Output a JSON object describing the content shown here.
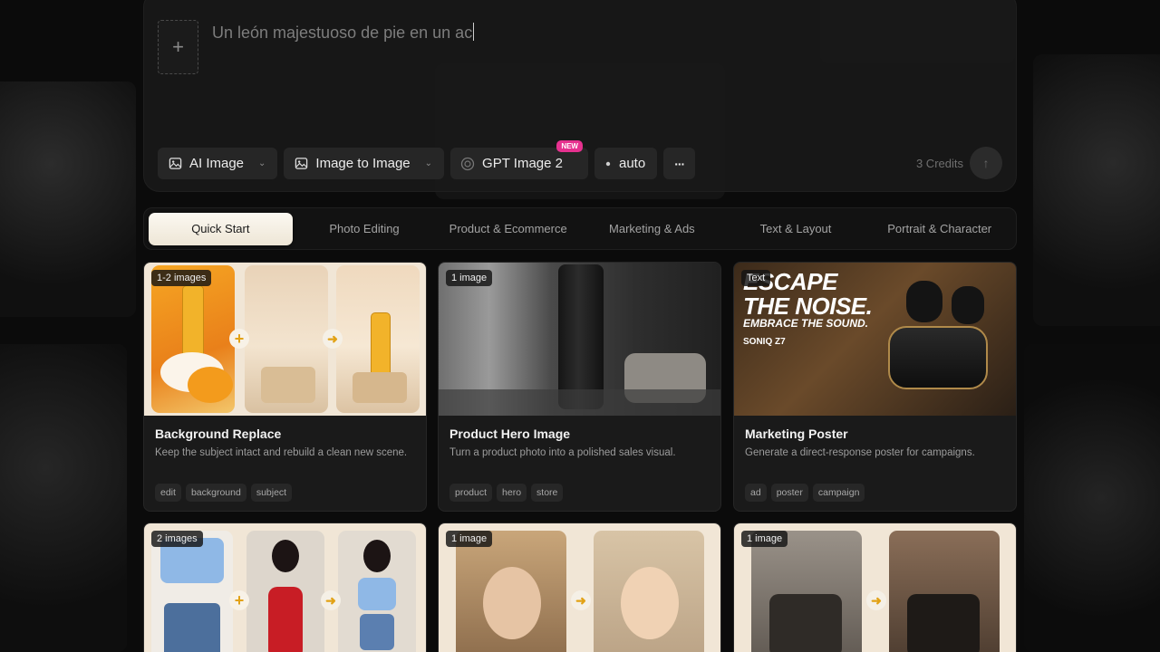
{
  "composer": {
    "add_icon": "plus-icon",
    "prompt_text": "Un león majestuoso de pie en un ac",
    "toolbar": [
      {
        "label": "AI Image",
        "icon": "image-icon",
        "dropdown": true
      },
      {
        "label": "Image to Image",
        "icon": "image-icon",
        "dropdown": true
      },
      {
        "label": "GPT Image 2",
        "icon": "openai-icon",
        "badge": "NEW"
      },
      {
        "label": "auto",
        "icon": "dot-icon"
      },
      {
        "label": "···",
        "icon": "more-icon"
      }
    ],
    "credits": "3 Credits",
    "send_icon": "arrow-up-icon"
  },
  "tabs": [
    {
      "label": "Quick Start",
      "active": true
    },
    {
      "label": "Photo Editing"
    },
    {
      "label": "Product & Ecommerce"
    },
    {
      "label": "Marketing & Ads"
    },
    {
      "label": "Text & Layout"
    },
    {
      "label": "Portrait & Character"
    }
  ],
  "cards": [
    {
      "badge": "1-2 images",
      "title": "Background Replace",
      "desc": "Keep the subject intact and rebuild a clean new scene.",
      "tags": [
        "edit",
        "background",
        "subject"
      ]
    },
    {
      "badge": "1 image",
      "title": "Product Hero Image",
      "desc": "Turn a product photo into a polished sales visual.",
      "tags": [
        "product",
        "hero",
        "store"
      ]
    },
    {
      "badge": "Text",
      "title": "Marketing Poster",
      "desc": "Generate a direct-response poster for campaigns.",
      "tags": [
        "ad",
        "poster",
        "campaign"
      ]
    },
    {
      "badge": "2 images"
    },
    {
      "badge": "1 image"
    },
    {
      "badge": "1 image"
    }
  ],
  "poster_art": {
    "line1": "ESCAPE",
    "line2": "THE NOISE.",
    "line3": "EMBRACE THE SOUND.",
    "line4": "SONIQ Z7"
  },
  "colors": {
    "accent_arrow": "#e2a216",
    "new_badge": "#e6318f",
    "active_tab_bg": "#f5efe3"
  }
}
